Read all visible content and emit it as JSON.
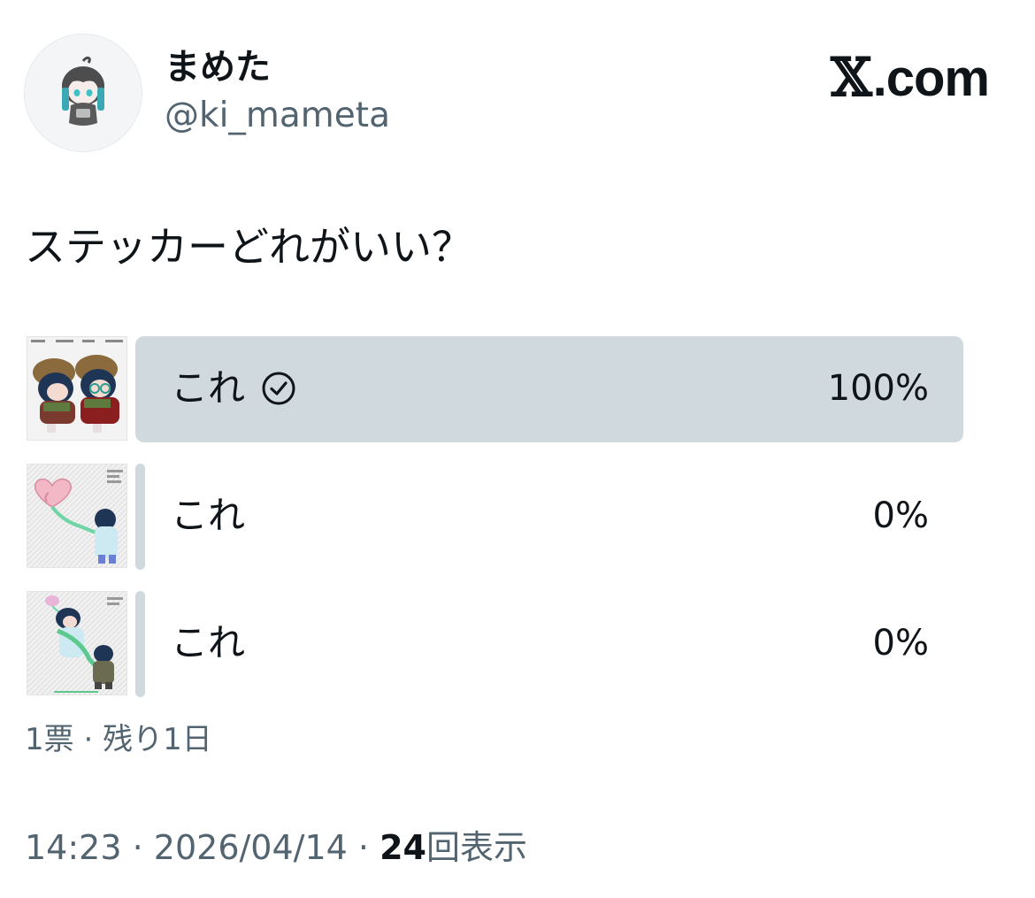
{
  "author": {
    "display_name": "まめた",
    "handle": "@ki_mameta"
  },
  "brand": {
    "x_glyph": "𝕏",
    "domain": ".com"
  },
  "tweet": {
    "text": "ステッカーどれがいい？"
  },
  "poll": {
    "options": [
      {
        "label": "これ",
        "percent": "100%",
        "selected": true,
        "share": 1.0
      },
      {
        "label": "これ",
        "percent": "0%",
        "selected": false,
        "share": 0.0
      },
      {
        "label": "これ",
        "percent": "0%",
        "selected": false,
        "share": 0.0
      }
    ],
    "votes": "1票",
    "separator": "·",
    "remaining": "残り1日"
  },
  "footer": {
    "time": "14:23",
    "separator": "·",
    "date": "2026/04/14",
    "views_count": "24",
    "views_label": "回表示"
  },
  "colors": {
    "text": "#0f1419",
    "secondary": "#536471",
    "poll_bar": "#cfd9de"
  },
  "icons": [
    "avatar",
    "check-circle-icon",
    "x-logo"
  ]
}
